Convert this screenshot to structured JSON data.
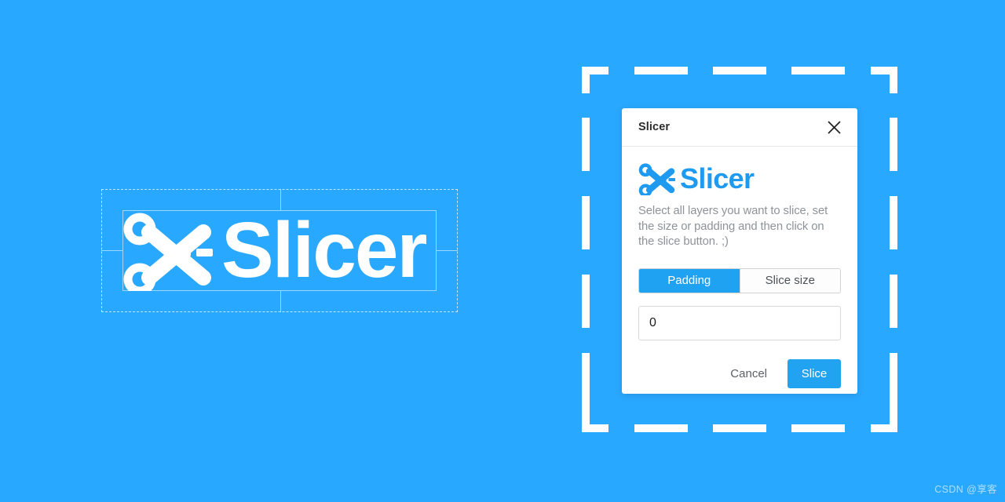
{
  "background_color": "#29a8ff",
  "accent_color": "#22a3f2",
  "hero": {
    "wordmark": "Slicer",
    "scissors_icon": "scissors-icon",
    "dash_icon": "dash-dash-icon"
  },
  "selection_frame": {
    "icon": "dashed-selection-frame"
  },
  "dialog": {
    "title": "Slicer",
    "close_icon": "close-icon",
    "brand": {
      "name": "Slicer",
      "scissors_icon": "scissors-icon"
    },
    "description": "Select all layers you want to slice, set the size or padding and then click on the slice button. ;)",
    "mode_toggle": {
      "options": [
        {
          "label": "Padding",
          "active": true
        },
        {
          "label": "Slice size",
          "active": false
        }
      ],
      "selected": "Padding"
    },
    "value_input": {
      "value": "0",
      "placeholder": "0"
    },
    "actions": {
      "cancel_label": "Cancel",
      "slice_label": "Slice"
    }
  },
  "watermark": "CSDN @享客"
}
